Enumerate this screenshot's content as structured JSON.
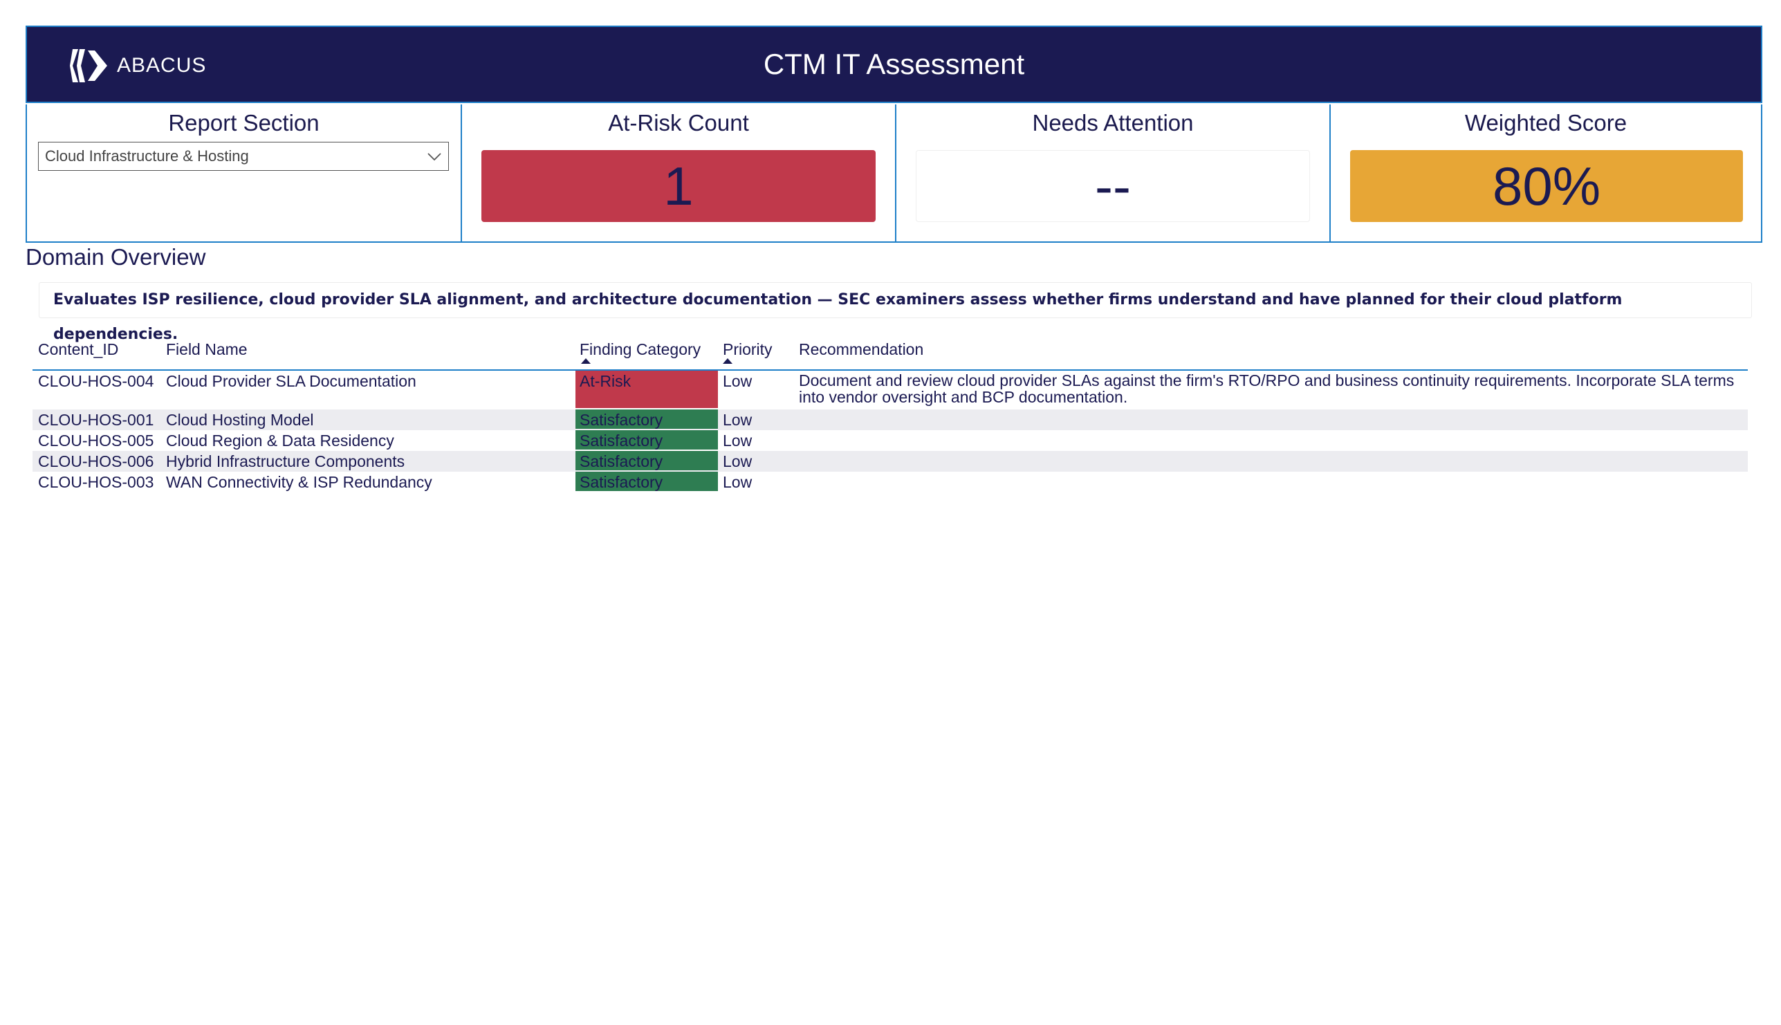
{
  "header": {
    "logo_text": "ABACUS",
    "title": "CTM IT Assessment"
  },
  "cards": {
    "report_section": {
      "title": "Report Section",
      "selected": "Cloud Infrastructure & Hosting"
    },
    "at_risk": {
      "title": "At-Risk Count",
      "value": "1",
      "color": "#c0394b"
    },
    "needs_attention": {
      "title": "Needs Attention",
      "value": "--"
    },
    "weighted_score": {
      "title": "Weighted Score",
      "value": "80%",
      "color": "#e7a636"
    }
  },
  "overview": {
    "heading": "Domain Overview",
    "description": "Evaluates ISP resilience, cloud provider SLA alignment, and architecture documentation — SEC examiners assess whether firms understand and have planned for their cloud platform dependencies."
  },
  "table": {
    "columns": [
      "Content_ID",
      "Field Name",
      "Finding Category",
      "Priority",
      "Recommendation"
    ],
    "rows": [
      {
        "id": "CLOU-HOS-004",
        "field": "Cloud Provider SLA Documentation",
        "category": "At-Risk",
        "priority": "Low",
        "recommendation_line1": "Document and review cloud provider SLAs against the firm's RTO/RPO and business continuity requirements. Incorporate SLA terms",
        "recommendation_line2": "into vendor oversight and BCP documentation."
      },
      {
        "id": "CLOU-HOS-001",
        "field": "Cloud Hosting Model",
        "category": "Satisfactory",
        "priority": "Low",
        "recommendation_line1": "",
        "recommendation_line2": ""
      },
      {
        "id": "CLOU-HOS-005",
        "field": "Cloud Region & Data Residency",
        "category": "Satisfactory",
        "priority": "Low",
        "recommendation_line1": "",
        "recommendation_line2": ""
      },
      {
        "id": "CLOU-HOS-006",
        "field": "Hybrid Infrastructure Components",
        "category": "Satisfactory",
        "priority": "Low",
        "recommendation_line1": "",
        "recommendation_line2": ""
      },
      {
        "id": "CLOU-HOS-003",
        "field": "WAN Connectivity & ISP Redundancy",
        "category": "Satisfactory",
        "priority": "Low",
        "recommendation_line1": "",
        "recommendation_line2": ""
      }
    ],
    "category_colors": {
      "At-Risk": "#c0394b",
      "Satisfactory": "#2e7d52"
    }
  }
}
